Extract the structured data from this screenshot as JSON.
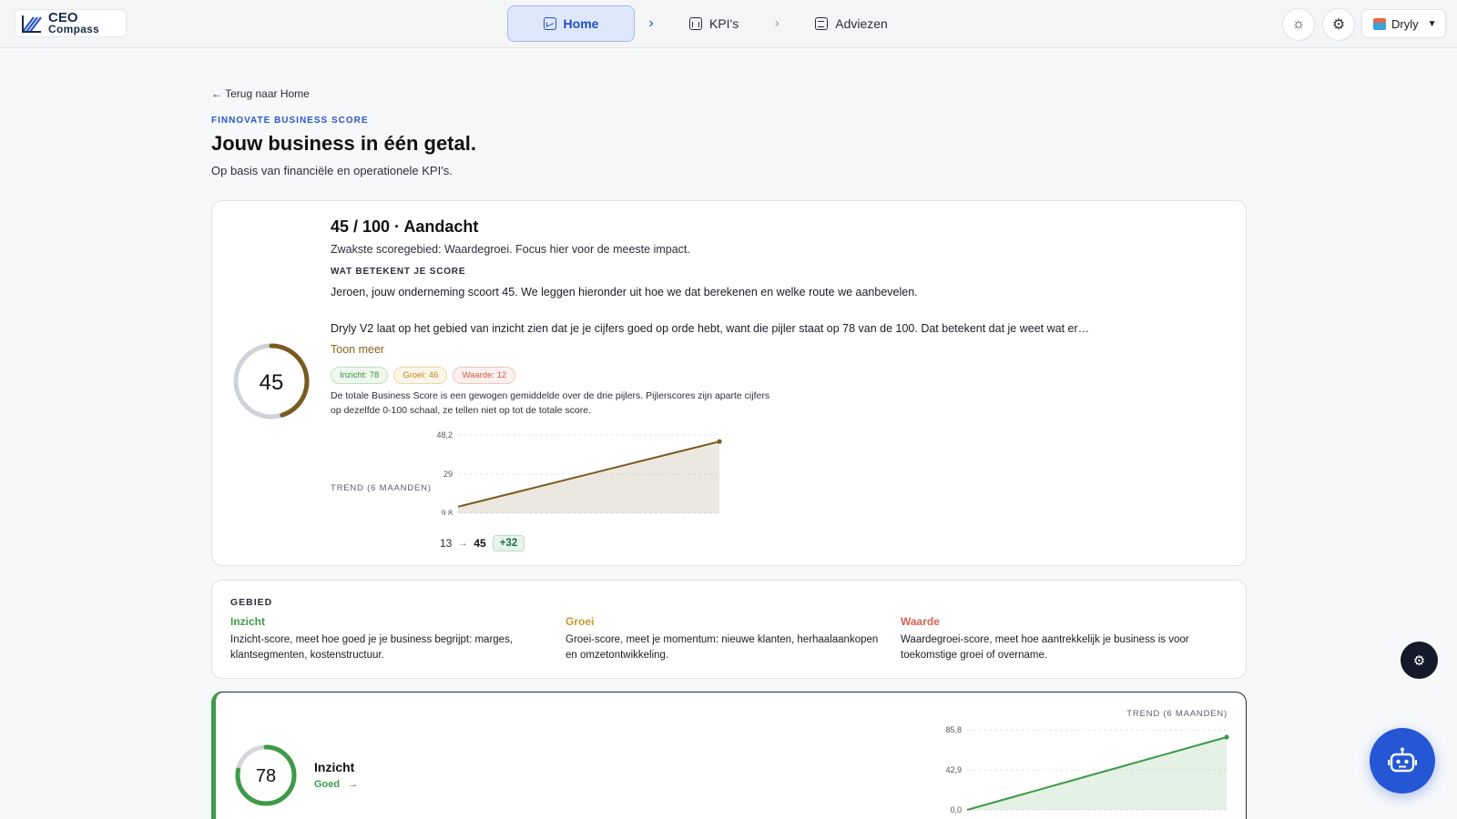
{
  "header": {
    "logo_line1": "CEO",
    "logo_line2": "Compass",
    "nav": [
      {
        "label": "Home"
      },
      {
        "label": "KPI's"
      },
      {
        "label": "Adviezen"
      }
    ],
    "user": "Dryly"
  },
  "page": {
    "back": "← Terug naar Home",
    "eyebrow": "FINNOVATE BUSINESS SCORE",
    "title": "Jouw business in één getal.",
    "subtitle": "Op basis van financiële en operationele KPI's."
  },
  "score": {
    "value": "45",
    "fraction": 0.45,
    "heading": "45 / 100 · Aandacht",
    "weakest": "Zwakste scoregebied: Waardegroei. Focus hier voor de meeste impact.",
    "explain_label": "WAT BETEKENT JE SCORE",
    "para1": "Jeroen, jouw onderneming scoort 45. We leggen hieronder uit hoe we dat berekenen en welke route we aanbevelen.",
    "para2": "Dryly V2 laat op het gebied van inzicht zien dat je je cijfers goed op orde hebt, want die pijler staat op 78 van de 100. Dat betekent dat je weet wat er…",
    "more": "Toon meer",
    "pills": [
      "Inzicht: 78",
      "Groei: 46",
      "Waarde: 12"
    ],
    "note": "De totale Business Score is een gewogen gemiddelde over de drie pijlers. Pijlerscores zijn aparte cijfers op dezelfde 0-100 schaal, ze tellen niet op tot de totale score.",
    "trend_label": "TREND (6 MAANDEN)",
    "trend_from": "13",
    "trend_arrow": "→",
    "trend_to": "45",
    "trend_delta": "+32"
  },
  "chart_data": [
    {
      "type": "area",
      "ticks": [
        "48,2",
        "29",
        "9,8"
      ],
      "ylim": [
        9.8,
        48.2
      ],
      "x": [
        0,
        1,
        2,
        3,
        4,
        5
      ],
      "values": [
        13,
        19.4,
        25.8,
        32.2,
        38.6,
        45
      ],
      "color": "#7a5a22"
    },
    {
      "type": "area",
      "ticks": [
        "85,8",
        "42,9",
        "0,0"
      ],
      "ylim": [
        0,
        85.8
      ],
      "x": [
        0,
        1,
        2,
        3,
        4,
        5
      ],
      "values": [
        0,
        15.6,
        31.2,
        46.8,
        62.4,
        78
      ],
      "color": "#3f9a48"
    }
  ],
  "areas": {
    "title": "GEBIED",
    "items": [
      {
        "name": "Inzicht",
        "color": "#3f9a48",
        "desc": "Inzicht-score, meet hoe goed je je business begrijpt: marges, klantsegmenten, kostenstructuur."
      },
      {
        "name": "Groei",
        "color": "#c39a2c",
        "desc": "Groei-score, meet je momentum: nieuwe klanten, herhaalaankopen en omzetontwikkeling."
      },
      {
        "name": "Waarde",
        "color": "#d9604f",
        "desc": "Waardegroei-score, meet hoe aantrekkelijk je business is voor toekomstige groei of overname."
      }
    ]
  },
  "pillar": {
    "value": "78",
    "fraction": 0.78,
    "name": "Inzicht",
    "status": "Goed",
    "status_arrow": "→",
    "trend_label": "TREND (6 MAANDEN)"
  },
  "colors": {
    "accent": "#2456d6",
    "gauge_main": "#7a5a22",
    "gauge_green": "#3f9a48"
  }
}
